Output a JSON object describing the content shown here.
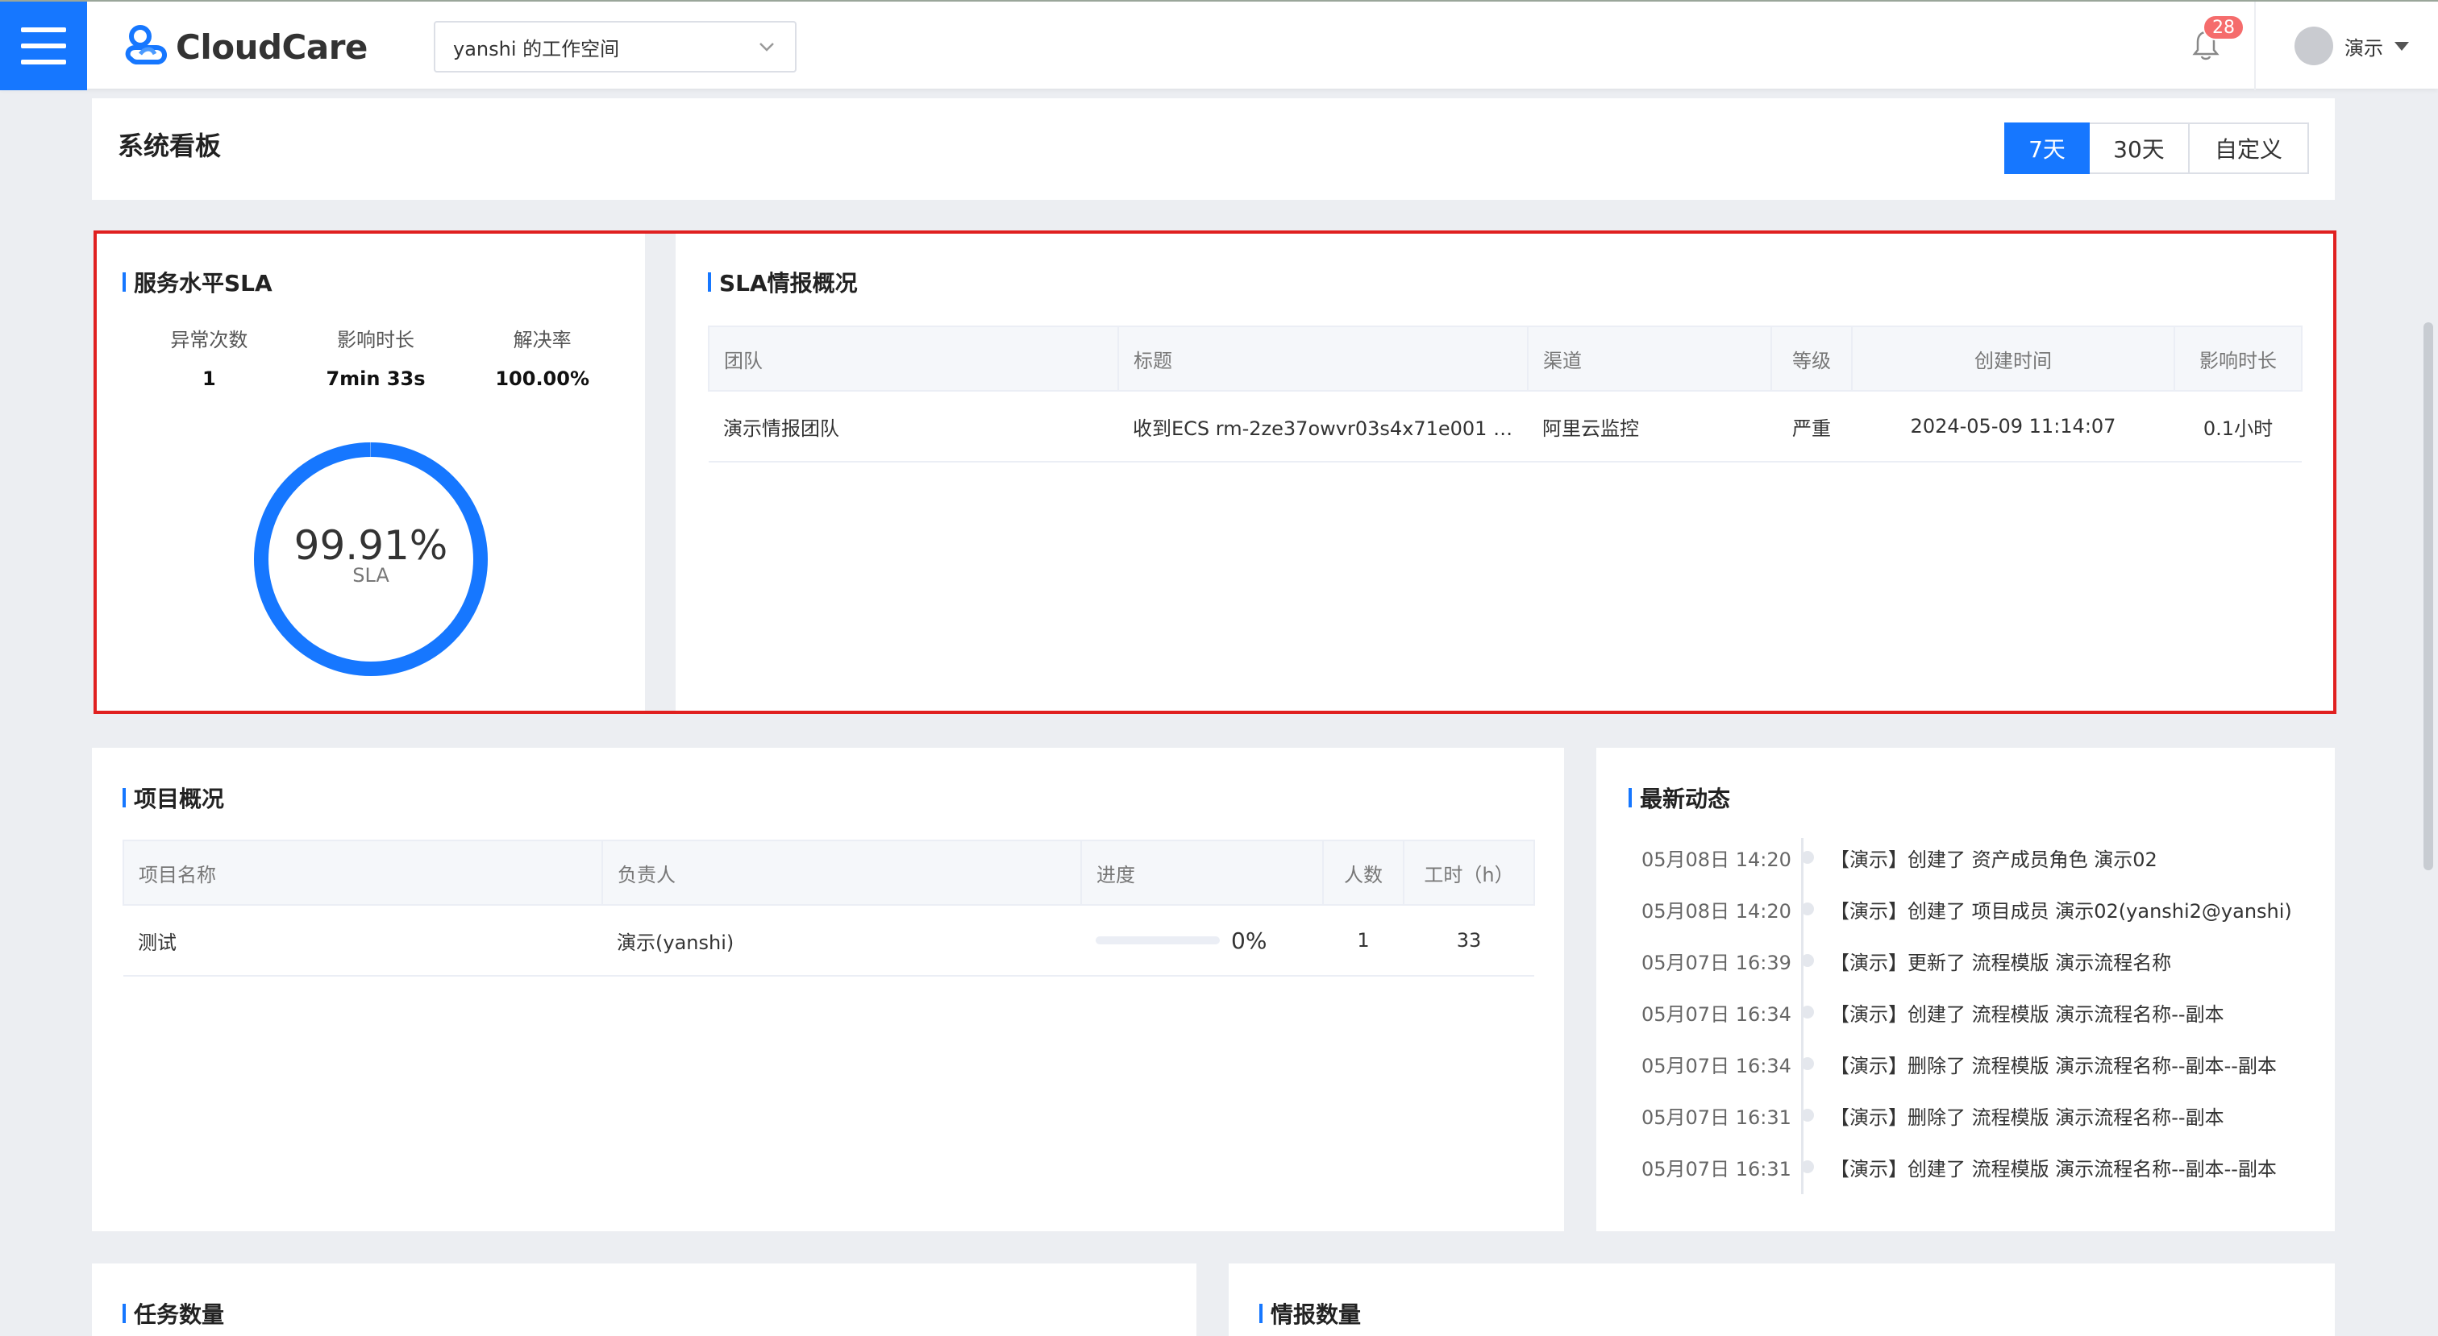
{
  "header": {
    "logo_text": "CloudCare",
    "workspace": "yanshi 的工作空间",
    "notification_count": "28",
    "user_name": "演示"
  },
  "dashboard": {
    "title": "系统看板",
    "ranges": [
      "7天",
      "30天",
      "自定义"
    ],
    "active_range": "7天"
  },
  "sla": {
    "title": "服务水平SLA",
    "stats": [
      {
        "label": "异常次数",
        "value": "1"
      },
      {
        "label": "影响时长",
        "value": "7min 33s"
      },
      {
        "label": "解决率",
        "value": "100.00%"
      }
    ],
    "percentage": "99.91%",
    "percentage_value": 99.91,
    "sub_label": "SLA",
    "ring_color": "#1677ff"
  },
  "sla_overview": {
    "title": "SLA情报概况",
    "columns": [
      "团队",
      "标题",
      "渠道",
      "等级",
      "创建时间",
      "影响时长"
    ],
    "rows": [
      [
        "演示情报团队",
        "收到ECS rm-2ze37owvr03s4x71e001 的…",
        "阿里云监控",
        "严重",
        "2024-05-09 11:14:07",
        "0.1小时"
      ]
    ]
  },
  "projects": {
    "title": "项目概况",
    "columns": [
      "项目名称",
      "负责人",
      "进度",
      "人数",
      "工时（h）"
    ],
    "rows": [
      {
        "name": "测试",
        "owner": "演示(yanshi)",
        "progress": 0,
        "progress_text": "0%",
        "members": "1",
        "hours": "33"
      }
    ]
  },
  "activity": {
    "title": "最新动态",
    "items": [
      {
        "time": "05月08日 14:20",
        "text": "【演示】创建了 资产成员角色 演示02"
      },
      {
        "time": "05月08日 14:20",
        "text": "【演示】创建了 项目成员 演示02(yanshi2@yanshi)"
      },
      {
        "time": "05月07日 16:39",
        "text": "【演示】更新了 流程模版 演示流程名称"
      },
      {
        "time": "05月07日 16:34",
        "text": "【演示】创建了 流程模版 演示流程名称--副本"
      },
      {
        "time": "05月07日 16:34",
        "text": "【演示】删除了 流程模版 演示流程名称--副本--副本"
      },
      {
        "time": "05月07日 16:31",
        "text": "【演示】删除了 流程模版 演示流程名称--副本"
      },
      {
        "time": "05月07日 16:31",
        "text": "【演示】创建了 流程模版 演示流程名称--副本--副本"
      }
    ]
  },
  "tasks": {
    "title": "任务数量"
  },
  "intel": {
    "title": "情报数量"
  },
  "colors": {
    "accent": "#1677ff",
    "highlight": "#e02020",
    "badge": "#f56c6c"
  }
}
